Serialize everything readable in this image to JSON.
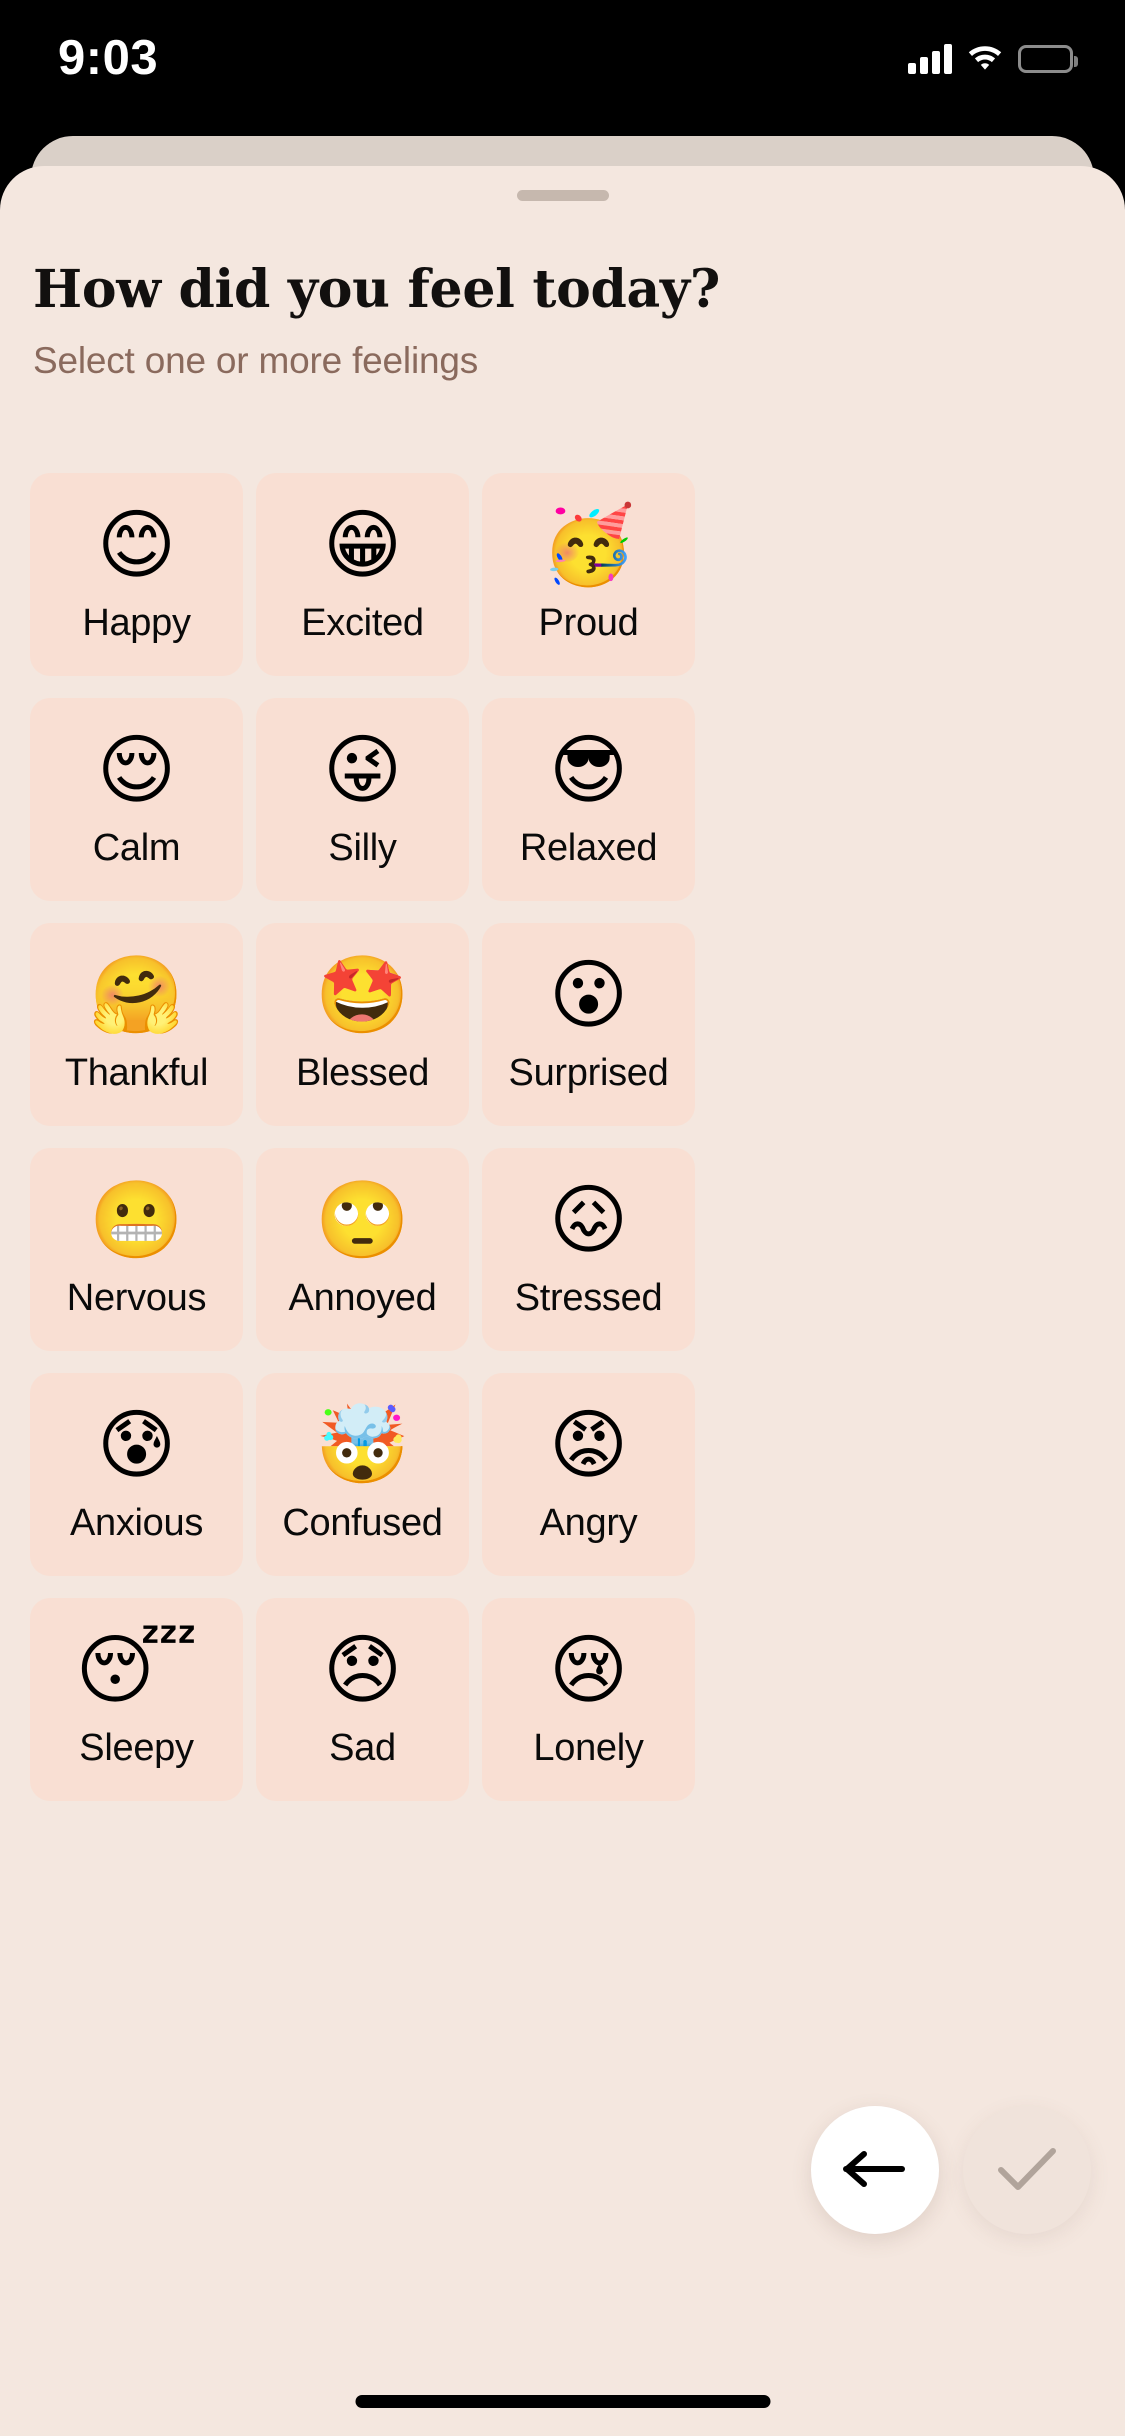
{
  "status_bar": {
    "time": "9:03",
    "cellular_icon": "signal-bars-icon",
    "wifi_icon": "wifi-icon",
    "battery_icon": "battery-full-icon"
  },
  "sheet": {
    "grabber": "sheet-grabber",
    "title": "How did you feel today?",
    "subtitle": "Select one or more feelings"
  },
  "feelings": [
    {
      "emoji": "😊",
      "emoji_name": "smiling-face-with-smiling-eyes",
      "label": "Happy",
      "selected": false
    },
    {
      "emoji": "😁",
      "emoji_name": "beaming-face-with-smiling-eyes",
      "label": "Excited",
      "selected": false
    },
    {
      "emoji": "🥳",
      "emoji_name": "partying-face",
      "label": "Proud",
      "selected": false
    },
    {
      "emoji": "😌",
      "emoji_name": "relieved-face",
      "label": "Calm",
      "selected": false
    },
    {
      "emoji": "😜",
      "emoji_name": "winking-face-with-tongue",
      "label": "Silly",
      "selected": false
    },
    {
      "emoji": "😎",
      "emoji_name": "smiling-face-with-sunglasses",
      "label": "Relaxed",
      "selected": false
    },
    {
      "emoji": "🤗",
      "emoji_name": "hugging-face",
      "label": "Thankful",
      "selected": false
    },
    {
      "emoji": "🤩",
      "emoji_name": "star-struck",
      "label": "Blessed",
      "selected": false
    },
    {
      "emoji": "😮",
      "emoji_name": "face-with-open-mouth",
      "label": "Surprised",
      "selected": false
    },
    {
      "emoji": "😬",
      "emoji_name": "grimacing-face",
      "label": "Nervous",
      "selected": false
    },
    {
      "emoji": "🙄",
      "emoji_name": "face-with-rolling-eyes",
      "label": "Annoyed",
      "selected": false
    },
    {
      "emoji": "😖",
      "emoji_name": "confounded-face",
      "label": "Stressed",
      "selected": false
    },
    {
      "emoji": "😰",
      "emoji_name": "anxious-face-with-sweat",
      "label": "Anxious",
      "selected": false
    },
    {
      "emoji": "🤯",
      "emoji_name": "exploding-head",
      "label": "Confused",
      "selected": false
    },
    {
      "emoji": "😡",
      "emoji_name": "pouting-face",
      "label": "Angry",
      "selected": false
    },
    {
      "emoji": "😴",
      "emoji_name": "sleeping-face",
      "label": "Sleepy",
      "selected": false
    },
    {
      "emoji": "😞",
      "emoji_name": "disappointed-face",
      "label": "Sad",
      "selected": false
    },
    {
      "emoji": "😢",
      "emoji_name": "crying-face",
      "label": "Lonely",
      "selected": false
    }
  ],
  "actions": {
    "back_icon": "arrow-left-icon",
    "confirm_icon": "checkmark-icon",
    "confirm_enabled": false
  },
  "colors": {
    "sheet_background": "#f4e7df",
    "sheet_behind": "#dad0c8",
    "card_background": "#f9dfd3",
    "title_text": "#12100f",
    "subtitle_text": "#8a6a5d",
    "label_text": "#0a0a0a",
    "fab_back_background": "#ffffff",
    "fab_back_icon": "#000000",
    "fab_confirm_background": "#f0e3db",
    "fab_confirm_icon": "#b1a49b",
    "grabber": "#c6b8ae",
    "status_bar_background": "#000000",
    "status_bar_foreground": "#ffffff"
  }
}
